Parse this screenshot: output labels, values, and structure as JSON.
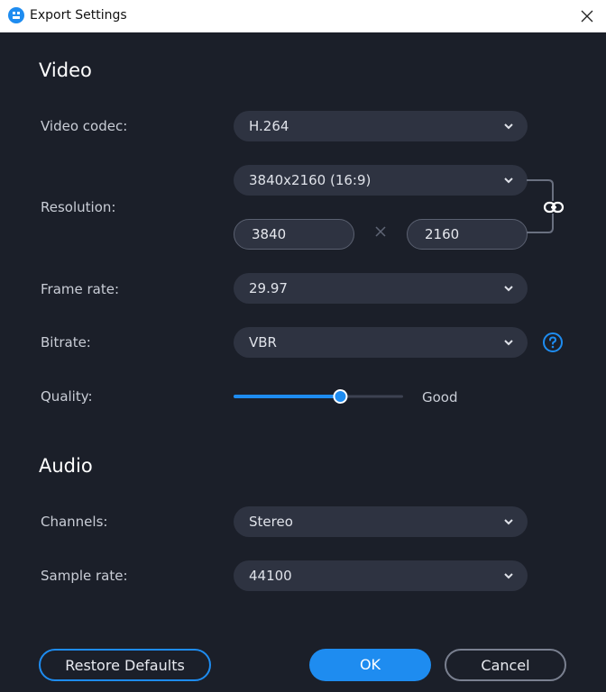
{
  "window": {
    "title": "Export Settings"
  },
  "video": {
    "heading": "Video",
    "codec": {
      "label": "Video codec:",
      "value": "H.264"
    },
    "resolution": {
      "label": "Resolution:",
      "value": "3840x2160 (16:9)",
      "width": "3840",
      "height": "2160"
    },
    "frame_rate": {
      "label": "Frame rate:",
      "value": "29.97"
    },
    "bitrate": {
      "label": "Bitrate:",
      "value": "VBR"
    },
    "quality": {
      "label": "Quality:",
      "value_text": "Good",
      "level": 0.63
    }
  },
  "audio": {
    "heading": "Audio",
    "channels": {
      "label": "Channels:",
      "value": "Stereo"
    },
    "sample_rate": {
      "label": "Sample rate:",
      "value": "44100"
    }
  },
  "buttons": {
    "restore": "Restore Defaults",
    "ok": "OK",
    "cancel": "Cancel"
  },
  "colors": {
    "accent": "#1e8cf0",
    "background": "#1b1f29",
    "field": "#2e3341"
  },
  "icons": [
    "app-icon",
    "close-icon",
    "chevron-down-icon",
    "link-icon",
    "help-icon",
    "times-icon"
  ]
}
